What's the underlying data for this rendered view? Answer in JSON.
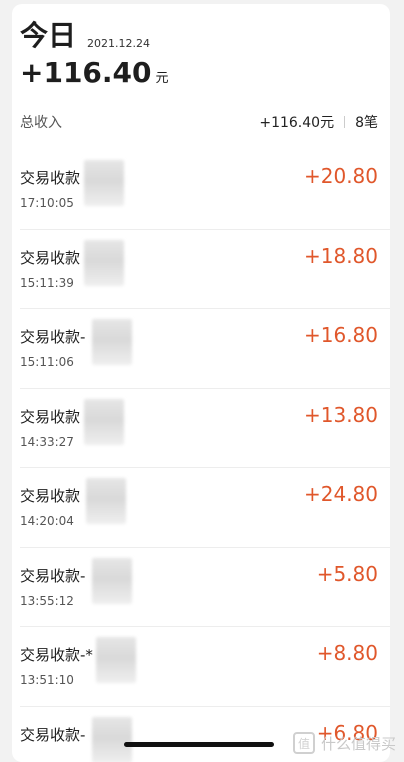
{
  "header": {
    "title": "今日",
    "date": "2021.12.24",
    "total": "+116.40",
    "unit": "元"
  },
  "summary": {
    "label": "总收入",
    "amount": "+116.40元",
    "count": "8笔"
  },
  "transactions": [
    {
      "label": "交易收款",
      "time": "17:10:05",
      "amount": "+20.80"
    },
    {
      "label": "交易收款",
      "time": "15:11:39",
      "amount": "+18.80"
    },
    {
      "label": "交易收款-",
      "time": "15:11:06",
      "amount": "+16.80"
    },
    {
      "label": "交易收款",
      "time": "14:33:27",
      "amount": "+13.80"
    },
    {
      "label": "交易收款",
      "time": "14:20:04",
      "amount": "+24.80"
    },
    {
      "label": "交易收款-",
      "time": "13:55:12",
      "amount": "+5.80"
    },
    {
      "label": "交易收款-*",
      "time": "13:51:10",
      "amount": "+8.80"
    },
    {
      "label": "交易收款-",
      "time": "",
      "amount": "+6.80"
    }
  ],
  "watermark": {
    "text": "什么值得买",
    "icon": "zhi-logo-icon"
  },
  "colors": {
    "amount": "#e0572b",
    "background": "#f2f2f2"
  }
}
